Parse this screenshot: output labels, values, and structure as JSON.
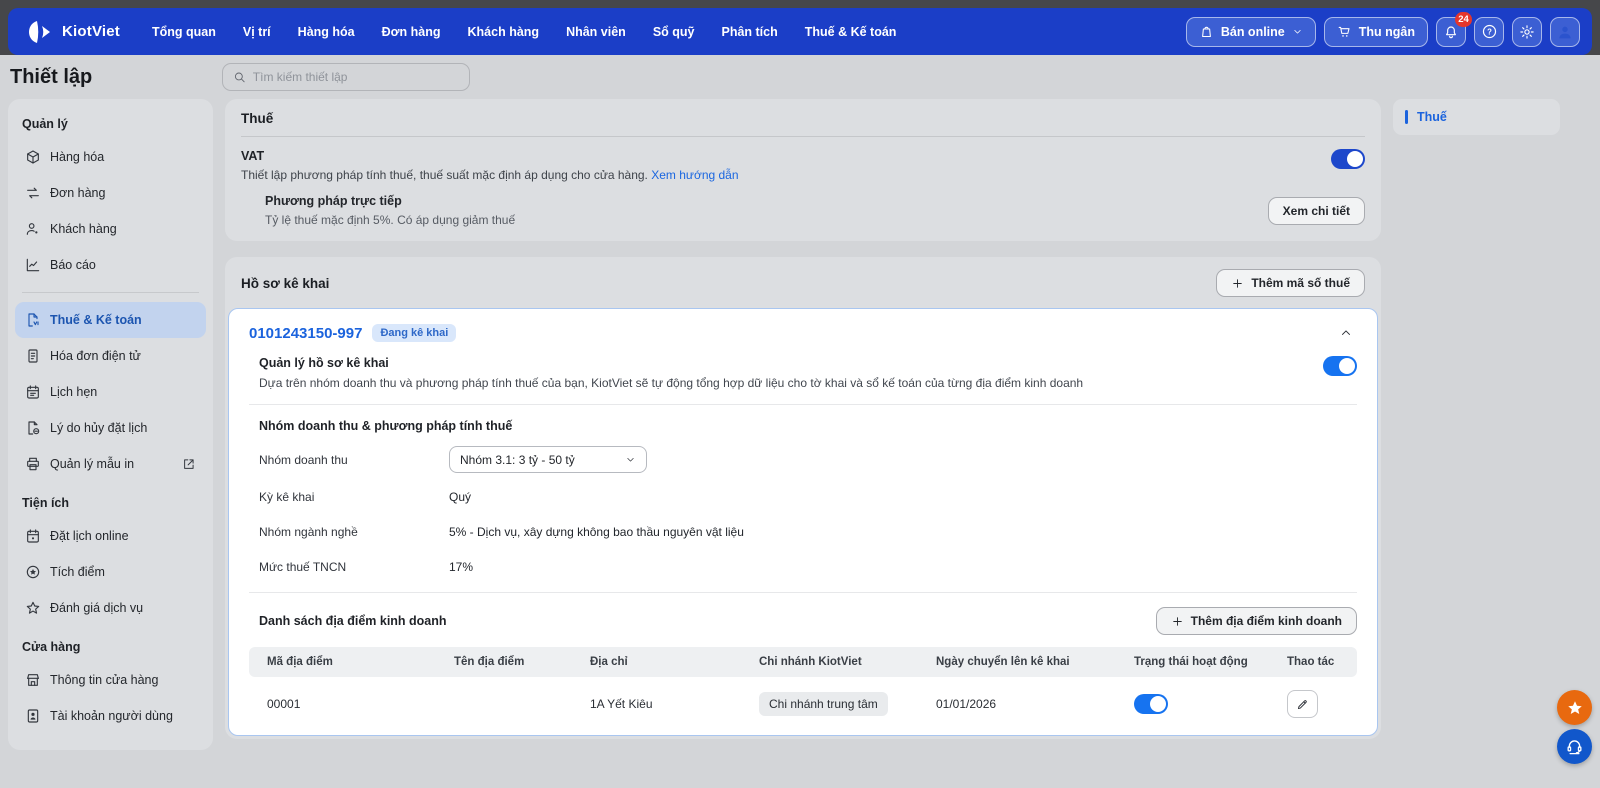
{
  "navbar": {
    "brand": "KiotViet",
    "items": [
      {
        "label": "Tổng quan"
      },
      {
        "label": "Vị trí"
      },
      {
        "label": "Hàng hóa"
      },
      {
        "label": "Đơn hàng"
      },
      {
        "label": "Khách hàng"
      },
      {
        "label": "Nhân viên"
      },
      {
        "label": "Sổ quỹ"
      },
      {
        "label": "Phân tích"
      },
      {
        "label": "Thuế & Kế toán"
      }
    ],
    "ban_online_label": "Bán online",
    "thu_ngan_label": "Thu ngân",
    "notification_count": "24"
  },
  "page": {
    "title": "Thiết lập",
    "search_placeholder": "Tìm kiếm thiết lập"
  },
  "sidebar": {
    "sections": [
      {
        "title": "Quản lý",
        "items": [
          {
            "label": "Hàng hóa"
          },
          {
            "label": "Đơn hàng"
          },
          {
            "label": "Khách hàng"
          },
          {
            "label": "Báo cáo"
          },
          {
            "label": "Thuế & Kế toán",
            "active": true
          },
          {
            "label": "Hóa đơn điện tử"
          },
          {
            "label": "Lịch hẹn"
          },
          {
            "label": "Lý do hủy đặt lịch"
          },
          {
            "label": "Quản lý mẫu in"
          }
        ]
      },
      {
        "title": "Tiện ích",
        "items": [
          {
            "label": "Đặt lịch online"
          },
          {
            "label": "Tích điểm"
          },
          {
            "label": "Đánh giá dịch vụ"
          }
        ]
      },
      {
        "title": "Cửa hàng",
        "items": [
          {
            "label": "Thông tin cửa hàng"
          },
          {
            "label": "Tài khoản người dùng"
          }
        ]
      }
    ]
  },
  "main": {
    "tax_section": {
      "title": "Thuế",
      "vat": {
        "label": "VAT",
        "description": "Thiết lập phương pháp tính thuế, thuế suất mặc định áp dụng cho cửa hàng.",
        "link": "Xem hướng dẫn",
        "enabled": true,
        "method_title": "Phương pháp trực tiếp",
        "method_description": "Tỷ lệ thuế mặc định 5%. Có áp dụng giảm thuế",
        "detail_button": "Xem chi tiết"
      }
    },
    "declaration_section": {
      "title": "Hồ sơ kê khai",
      "add_tax_code_button": "Thêm mã số thuế",
      "card": {
        "tax_code": "0101243150-997",
        "status_badge": "Đang kê khai",
        "manage": {
          "title": "Quản lý hồ sơ kê khai",
          "description": "Dựa trên nhóm doanh thu và phương pháp tính thuế của bạn, KiotViet sẽ tự động tổng hợp dữ liệu cho tờ khai và sổ kế toán của từng địa điểm kinh doanh",
          "enabled": true
        },
        "group_title": "Nhóm doanh thu & phương pháp tính thuế",
        "fields": [
          {
            "label": "Nhóm doanh thu",
            "value": "Nhóm 3.1: 3 tỷ - 50 tỷ",
            "type": "select"
          },
          {
            "label": "Kỳ kê khai",
            "value": "Quý"
          },
          {
            "label": "Nhóm ngành nghề",
            "value": "5% - Dịch vụ, xây dựng không bao thầu nguyên vật liệu"
          },
          {
            "label": "Mức thuế TNCN",
            "value": "17%"
          }
        ],
        "locations": {
          "title": "Danh sách địa điểm kinh doanh",
          "add_button": "Thêm địa điểm kinh doanh",
          "headers": [
            "Mã địa điểm",
            "Tên địa điểm",
            "Địa chỉ",
            "Chi nhánh KiotViet",
            "Ngày chuyển lên kê khai",
            "Trạng thái hoạt động",
            "Thao tác"
          ],
          "rows": [
            {
              "code": "00001",
              "name": "",
              "address": "1A Yết Kiêu",
              "branch": "Chi nhánh trung tâm",
              "date": "01/01/2026",
              "active": true
            }
          ]
        }
      }
    }
  },
  "anchor_nav": {
    "items": [
      {
        "label": "Thuế",
        "active": true
      }
    ]
  },
  "colors": {
    "navbar_blue": "#1b3ec7",
    "toggle_blue": "#1673f0",
    "toggle_navy": "#1d47cb",
    "link_blue": "#1a66e0",
    "badge_red": "#e5362c",
    "floating_orange": "#e8690f",
    "floating_blue": "#1157cb"
  }
}
